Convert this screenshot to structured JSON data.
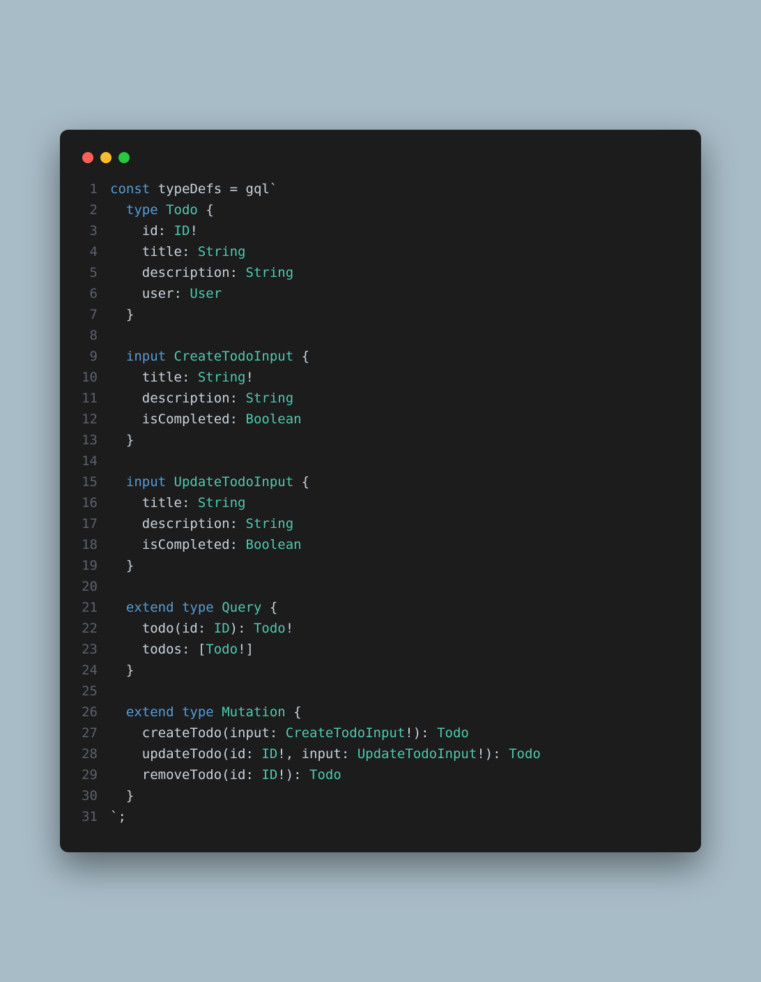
{
  "window": {
    "traffic_lights": [
      "close",
      "minimize",
      "zoom"
    ]
  },
  "code": {
    "lines": [
      {
        "n": 1,
        "tokens": [
          [
            "kw",
            "const"
          ],
          [
            "punc",
            " "
          ],
          [
            "field",
            "typeDefs"
          ],
          [
            "punc",
            " "
          ],
          [
            "op",
            "="
          ],
          [
            "punc",
            " "
          ],
          [
            "field",
            "gql"
          ],
          [
            "punc",
            "`"
          ]
        ]
      },
      {
        "n": 2,
        "tokens": [
          [
            "punc",
            "  "
          ],
          [
            "kw",
            "type"
          ],
          [
            "punc",
            " "
          ],
          [
            "name",
            "Todo"
          ],
          [
            "punc",
            " {"
          ]
        ]
      },
      {
        "n": 3,
        "tokens": [
          [
            "punc",
            "    "
          ],
          [
            "field",
            "id"
          ],
          [
            "punc",
            ": "
          ],
          [
            "name",
            "ID"
          ],
          [
            "punc",
            "!"
          ]
        ]
      },
      {
        "n": 4,
        "tokens": [
          [
            "punc",
            "    "
          ],
          [
            "field",
            "title"
          ],
          [
            "punc",
            ": "
          ],
          [
            "name",
            "String"
          ]
        ]
      },
      {
        "n": 5,
        "tokens": [
          [
            "punc",
            "    "
          ],
          [
            "field",
            "description"
          ],
          [
            "punc",
            ": "
          ],
          [
            "name",
            "String"
          ]
        ]
      },
      {
        "n": 6,
        "tokens": [
          [
            "punc",
            "    "
          ],
          [
            "field",
            "user"
          ],
          [
            "punc",
            ": "
          ],
          [
            "name",
            "User"
          ]
        ]
      },
      {
        "n": 7,
        "tokens": [
          [
            "punc",
            "  }"
          ]
        ]
      },
      {
        "n": 8,
        "tokens": [
          [
            "punc",
            ""
          ]
        ]
      },
      {
        "n": 9,
        "tokens": [
          [
            "punc",
            "  "
          ],
          [
            "kw",
            "input"
          ],
          [
            "punc",
            " "
          ],
          [
            "name",
            "CreateTodoInput"
          ],
          [
            "punc",
            " {"
          ]
        ]
      },
      {
        "n": 10,
        "tokens": [
          [
            "punc",
            "    "
          ],
          [
            "field",
            "title"
          ],
          [
            "punc",
            ": "
          ],
          [
            "name",
            "String"
          ],
          [
            "punc",
            "!"
          ]
        ]
      },
      {
        "n": 11,
        "tokens": [
          [
            "punc",
            "    "
          ],
          [
            "field",
            "description"
          ],
          [
            "punc",
            ": "
          ],
          [
            "name",
            "String"
          ]
        ]
      },
      {
        "n": 12,
        "tokens": [
          [
            "punc",
            "    "
          ],
          [
            "field",
            "isCompleted"
          ],
          [
            "punc",
            ": "
          ],
          [
            "name",
            "Boolean"
          ]
        ]
      },
      {
        "n": 13,
        "tokens": [
          [
            "punc",
            "  }"
          ]
        ]
      },
      {
        "n": 14,
        "tokens": [
          [
            "punc",
            ""
          ]
        ]
      },
      {
        "n": 15,
        "tokens": [
          [
            "punc",
            "  "
          ],
          [
            "kw",
            "input"
          ],
          [
            "punc",
            " "
          ],
          [
            "name",
            "UpdateTodoInput"
          ],
          [
            "punc",
            " {"
          ]
        ]
      },
      {
        "n": 16,
        "tokens": [
          [
            "punc",
            "    "
          ],
          [
            "field",
            "title"
          ],
          [
            "punc",
            ": "
          ],
          [
            "name",
            "String"
          ]
        ]
      },
      {
        "n": 17,
        "tokens": [
          [
            "punc",
            "    "
          ],
          [
            "field",
            "description"
          ],
          [
            "punc",
            ": "
          ],
          [
            "name",
            "String"
          ]
        ]
      },
      {
        "n": 18,
        "tokens": [
          [
            "punc",
            "    "
          ],
          [
            "field",
            "isCompleted"
          ],
          [
            "punc",
            ": "
          ],
          [
            "name",
            "Boolean"
          ]
        ]
      },
      {
        "n": 19,
        "tokens": [
          [
            "punc",
            "  }"
          ]
        ]
      },
      {
        "n": 20,
        "tokens": [
          [
            "punc",
            ""
          ]
        ]
      },
      {
        "n": 21,
        "tokens": [
          [
            "punc",
            "  "
          ],
          [
            "kw",
            "extend"
          ],
          [
            "punc",
            " "
          ],
          [
            "kw",
            "type"
          ],
          [
            "punc",
            " "
          ],
          [
            "name",
            "Query"
          ],
          [
            "punc",
            " {"
          ]
        ]
      },
      {
        "n": 22,
        "tokens": [
          [
            "punc",
            "    "
          ],
          [
            "field",
            "todo"
          ],
          [
            "punc",
            "("
          ],
          [
            "field",
            "id"
          ],
          [
            "punc",
            ": "
          ],
          [
            "name",
            "ID"
          ],
          [
            "punc",
            "): "
          ],
          [
            "name",
            "Todo"
          ],
          [
            "punc",
            "!"
          ]
        ]
      },
      {
        "n": 23,
        "tokens": [
          [
            "punc",
            "    "
          ],
          [
            "field",
            "todos"
          ],
          [
            "punc",
            ": ["
          ],
          [
            "name",
            "Todo"
          ],
          [
            "punc",
            "!]"
          ]
        ]
      },
      {
        "n": 24,
        "tokens": [
          [
            "punc",
            "  }"
          ]
        ]
      },
      {
        "n": 25,
        "tokens": [
          [
            "punc",
            ""
          ]
        ]
      },
      {
        "n": 26,
        "tokens": [
          [
            "punc",
            "  "
          ],
          [
            "kw",
            "extend"
          ],
          [
            "punc",
            " "
          ],
          [
            "kw",
            "type"
          ],
          [
            "punc",
            " "
          ],
          [
            "name",
            "Mutation"
          ],
          [
            "punc",
            " {"
          ]
        ]
      },
      {
        "n": 27,
        "tokens": [
          [
            "punc",
            "    "
          ],
          [
            "field",
            "createTodo"
          ],
          [
            "punc",
            "("
          ],
          [
            "field",
            "input"
          ],
          [
            "punc",
            ": "
          ],
          [
            "name",
            "CreateTodoInput"
          ],
          [
            "punc",
            "!): "
          ],
          [
            "name",
            "Todo"
          ]
        ]
      },
      {
        "n": 28,
        "tokens": [
          [
            "punc",
            "    "
          ],
          [
            "field",
            "updateTodo"
          ],
          [
            "punc",
            "("
          ],
          [
            "field",
            "id"
          ],
          [
            "punc",
            ": "
          ],
          [
            "name",
            "ID"
          ],
          [
            "punc",
            "!, "
          ],
          [
            "field",
            "input"
          ],
          [
            "punc",
            ": "
          ],
          [
            "name",
            "UpdateTodoInput"
          ],
          [
            "punc",
            "!): "
          ],
          [
            "name",
            "Todo"
          ]
        ]
      },
      {
        "n": 29,
        "tokens": [
          [
            "punc",
            "    "
          ],
          [
            "field",
            "removeTodo"
          ],
          [
            "punc",
            "("
          ],
          [
            "field",
            "id"
          ],
          [
            "punc",
            ": "
          ],
          [
            "name",
            "ID"
          ],
          [
            "punc",
            "!): "
          ],
          [
            "name",
            "Todo"
          ]
        ]
      },
      {
        "n": 30,
        "tokens": [
          [
            "punc",
            "  }"
          ]
        ]
      },
      {
        "n": 31,
        "tokens": [
          [
            "punc",
            "`;"
          ]
        ]
      }
    ]
  }
}
